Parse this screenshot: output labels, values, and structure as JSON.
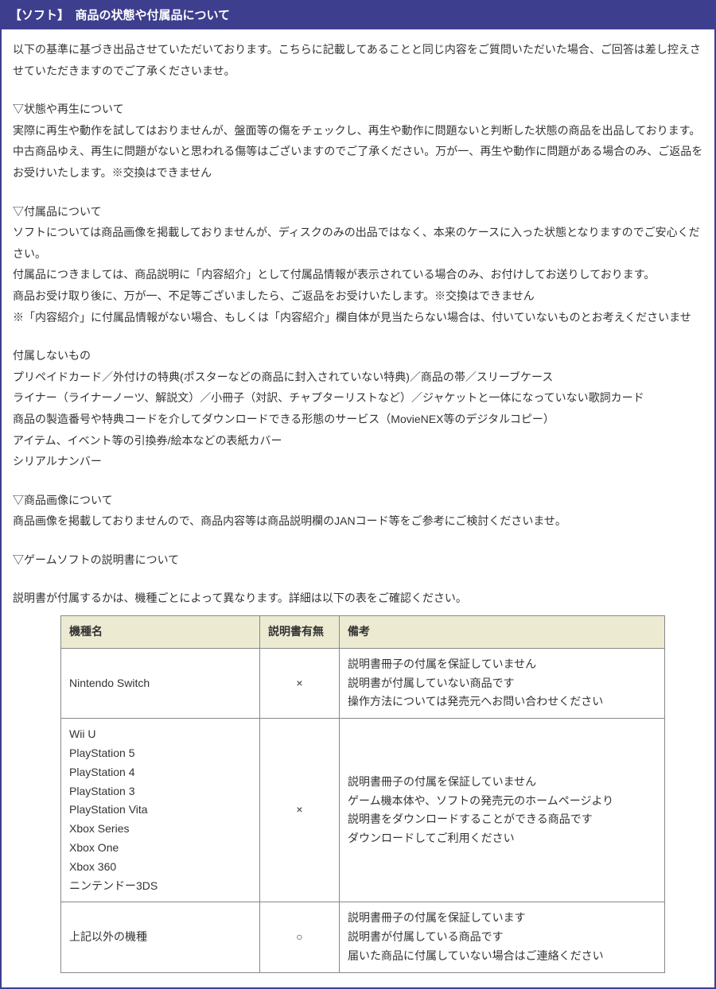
{
  "header": {
    "title": "【ソフト】　商品の状態や付属品について"
  },
  "intro": {
    "p1": "以下の基準に基づき出品させていただいております。こちらに記載してあることと同じ内容をご質問いただいた場合、ご回答は差し控えさせていただきますのでご了承くださいませ。"
  },
  "s1": {
    "h": "▽状態や再生について",
    "p1": "実際に再生や動作を試してはおりませんが、盤面等の傷をチェックし、再生や動作に問題ないと判断した状態の商品を出品しております。中古商品ゆえ、再生に問題がないと思われる傷等はございますのでご了承ください。万が一、再生や動作に問題がある場合のみ、ご返品をお受けいたします。※交換はできません"
  },
  "s2": {
    "h": "▽付属品について",
    "p1": "ソフトについては商品画像を掲載しておりませんが、ディスクのみの出品ではなく、本来のケースに入った状態となりますのでご安心ください。",
    "p2": "付属品につきましては、商品説明に「内容紹介」として付属品情報が表示されている場合のみ、お付けしてお送りしております。",
    "p3": "商品お受け取り後に、万が一、不足等ございましたら、ご返品をお受けいたします。※交換はできません",
    "p4": "※「内容紹介」に付属品情報がない場合、もしくは「内容紹介」欄自体が見当たらない場合は、付いていないものとお考えくださいませ"
  },
  "s3": {
    "h": "付属しないもの",
    "p1": "プリペイドカード／外付けの特典(ポスターなどの商品に封入されていない特典)／商品の帯／スリーブケース",
    "p2": "ライナー（ライナーノーツ、解説文）／小冊子（対訳、チャプターリストなど）／ジャケットと一体になっていない歌詞カード",
    "p3": "商品の製造番号や特典コードを介してダウンロードできる形態のサービス（MovieNEX等のデジタルコピー）",
    "p4": "アイテム、イベント等の引換券/絵本などの表紙カバー",
    "p5": "シリアルナンバー"
  },
  "s4": {
    "h": "▽商品画像について",
    "p1": "商品画像を掲載しておりませんので、商品内容等は商品説明欄のJANコード等をご参考にご検討くださいませ。"
  },
  "s5": {
    "h": "▽ゲームソフトの説明書について",
    "p1": "説明書が付属するかは、機種ごとによって異なります。詳細は以下の表をご確認ください。"
  },
  "table": {
    "headers": {
      "c1": "機種名",
      "c2": "説明書有無",
      "c3": "備考"
    },
    "rows": [
      {
        "name_lines": [
          "Nintendo Switch"
        ],
        "has": "×",
        "note_lines": [
          "説明書冊子の付属を保証していません",
          "説明書が付属していない商品です",
          "操作方法については発売元へお問い合わせください"
        ]
      },
      {
        "name_lines": [
          "Wii U",
          "PlayStation 5",
          "PlayStation 4",
          "PlayStation 3",
          "PlayStation Vita",
          "Xbox Series",
          "Xbox One",
          "Xbox 360",
          "ニンテンドー3DS"
        ],
        "has": "×",
        "note_lines": [
          "説明書冊子の付属を保証していません",
          "ゲーム機本体や、ソフトの発売元のホームページより",
          "説明書をダウンロードすることができる商品です",
          "ダウンロードしてご利用ください"
        ]
      },
      {
        "name_lines": [
          "上記以外の機種"
        ],
        "has": "○",
        "note_lines": [
          "説明書冊子の付属を保証しています",
          "説明書が付属している商品です",
          "届いた商品に付属していない場合はご連絡ください"
        ]
      }
    ]
  }
}
